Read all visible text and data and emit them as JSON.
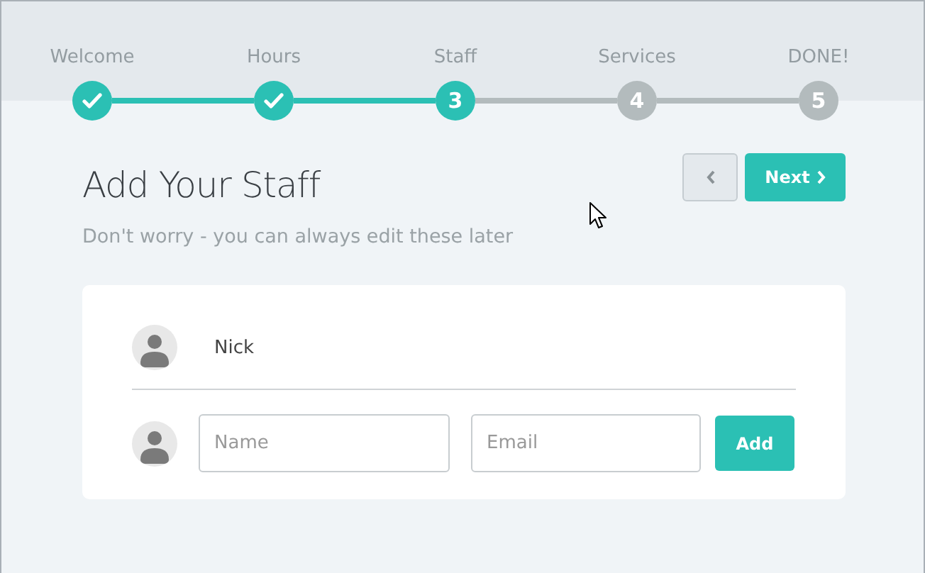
{
  "steps": [
    {
      "label": "Welcome",
      "completed": true,
      "selected": false
    },
    {
      "label": "Hours",
      "completed": true,
      "selected": false
    },
    {
      "label": "Staff",
      "number": "3",
      "completed": false,
      "selected": true
    },
    {
      "label": "Services",
      "number": "4",
      "completed": false,
      "selected": false
    },
    {
      "label": "DONE!",
      "number": "5",
      "completed": false,
      "selected": false
    }
  ],
  "title": "Add Your Staff",
  "subtitle": "Don't worry - you can always edit these later",
  "next_button": "Next",
  "staff": [
    {
      "name": "Nick"
    }
  ],
  "new_staff": {
    "name_placeholder": "Name",
    "email_placeholder": "Email",
    "add_button": "Add"
  }
}
